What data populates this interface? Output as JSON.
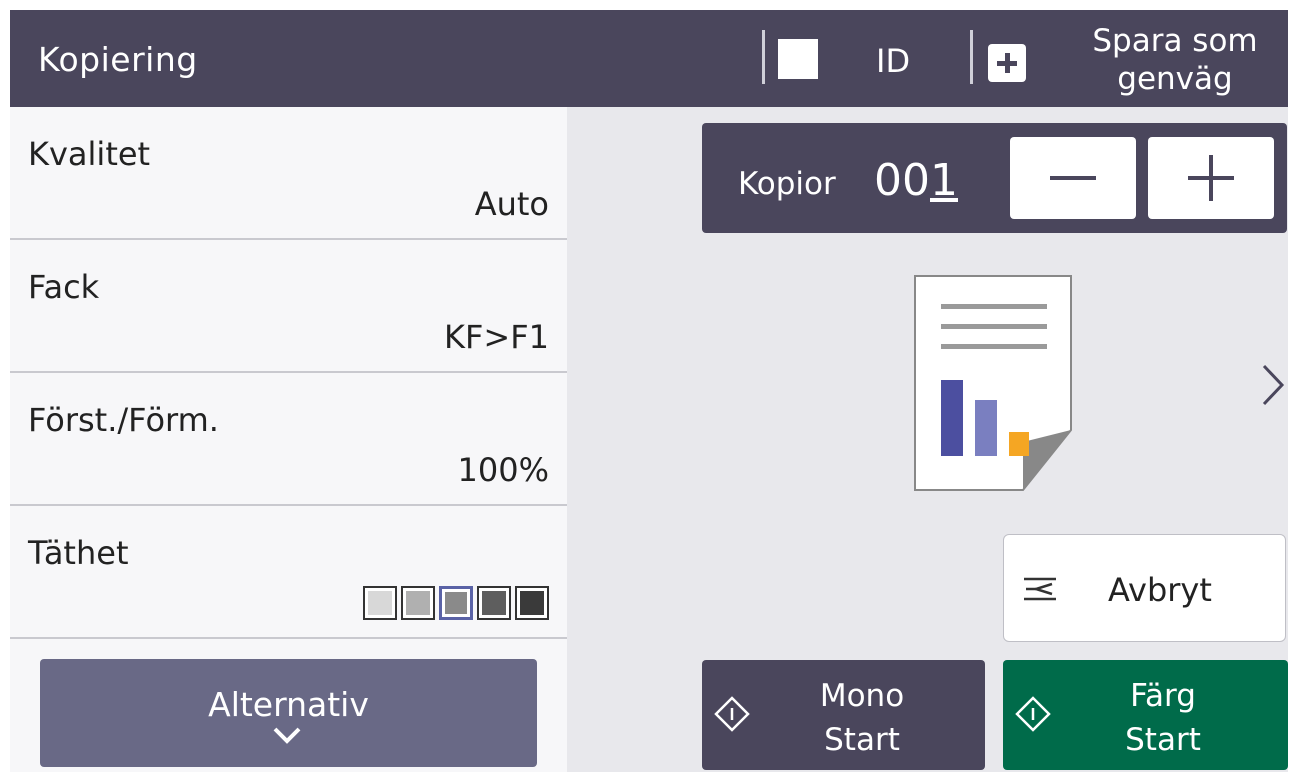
{
  "header": {
    "title": "Kopiering",
    "id_label": "ID",
    "shortcut_line1": "Spara som",
    "shortcut_line2": "genväg"
  },
  "settings": [
    {
      "label": "Kvalitet",
      "value": "Auto"
    },
    {
      "label": "Fack",
      "value": "KF>F1"
    },
    {
      "label": "Först./Förm.",
      "value": "100%"
    },
    {
      "label": "Täthet",
      "density_level": 3,
      "density_steps": 5
    }
  ],
  "options_button": {
    "label": "Alternativ"
  },
  "copies": {
    "label": "Kopior",
    "value_prefix": "00",
    "value_cursor": "1"
  },
  "cancel_button": {
    "label": "Avbryt"
  },
  "mono_start": {
    "line1": "Mono",
    "line2": "Start"
  },
  "color_start": {
    "line1": "Färg",
    "line2": "Start"
  },
  "colors": {
    "header_bg": "#4a465c",
    "options_button": "#696986",
    "color_start": "#006b4a",
    "density_selected": "#5a62a6",
    "chart_blue_dark": "#4c4fa0",
    "chart_blue_light": "#7a7fc0",
    "chart_orange": "#f5a623"
  }
}
